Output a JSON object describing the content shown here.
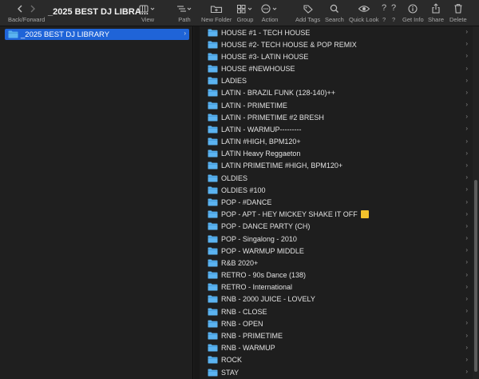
{
  "toolbar": {
    "title": "_2025 BEST DJ LIBRA...",
    "back_forward_label": "Back/Forward",
    "view_label": "View",
    "path_label": "Path",
    "new_folder_label": "New Folder",
    "group_label": "Group",
    "action_label": "Action",
    "add_tags_label": "Add Tags",
    "search_label": "Search",
    "quick_look_label": "Quick Look",
    "unknown_1_label": "?",
    "unknown_2_label": "?",
    "get_info_label": "Get Info",
    "share_label": "Share",
    "delete_label": "Delete",
    "unknown_1_icon": "?",
    "unknown_2_icon": "?"
  },
  "sidebar": {
    "selected_folder": "_2025 BEST DJ LIBRARY"
  },
  "files": [
    "HOUSE #1  - TECH HOUSE",
    "HOUSE #2- TECH HOUSE & POP REMIX",
    "HOUSE #3- LATIN HOUSE",
    "HOUSE #NEWHOUSE",
    "LADIES",
    "LATIN - BRAZIL FUNK (128-140)++",
    "LATIN - PRIMETIME",
    "LATIN - PRIMETIME #2 BRESH",
    "LATIN - WARMUP---------",
    "LATIN #HIGH,  BPM120+",
    "LATIN Heavy Reggaeton",
    "LATIN PRIMETIME #HIGH,  BPM120+",
    "OLDIES",
    "OLDIES #100",
    "POP - #DANCE",
    "POP - APT - HEY MICKEY  SHAKE IT OFF",
    "POP - DANCE PARTY (CH)",
    "POP - Singalong - 2010",
    "POP - WARMUP MIDDLE",
    "R&B 2020+",
    "RETRO - 90s Dance (138)",
    "RETRO - International",
    "RNB - 2000 JUICE - LOVELY",
    "RNB - CLOSE",
    "RNB - OPEN",
    "RNB - PRIMETIME",
    "RNB - WARMUP",
    "ROCK",
    "STAY"
  ],
  "colors": {
    "selection": "#1f64d8",
    "folder": "#5bb3f0",
    "emoji": "#f2c22c"
  },
  "icons": {
    "folder": "folder-icon",
    "chevron": "chevron-right-icon"
  }
}
